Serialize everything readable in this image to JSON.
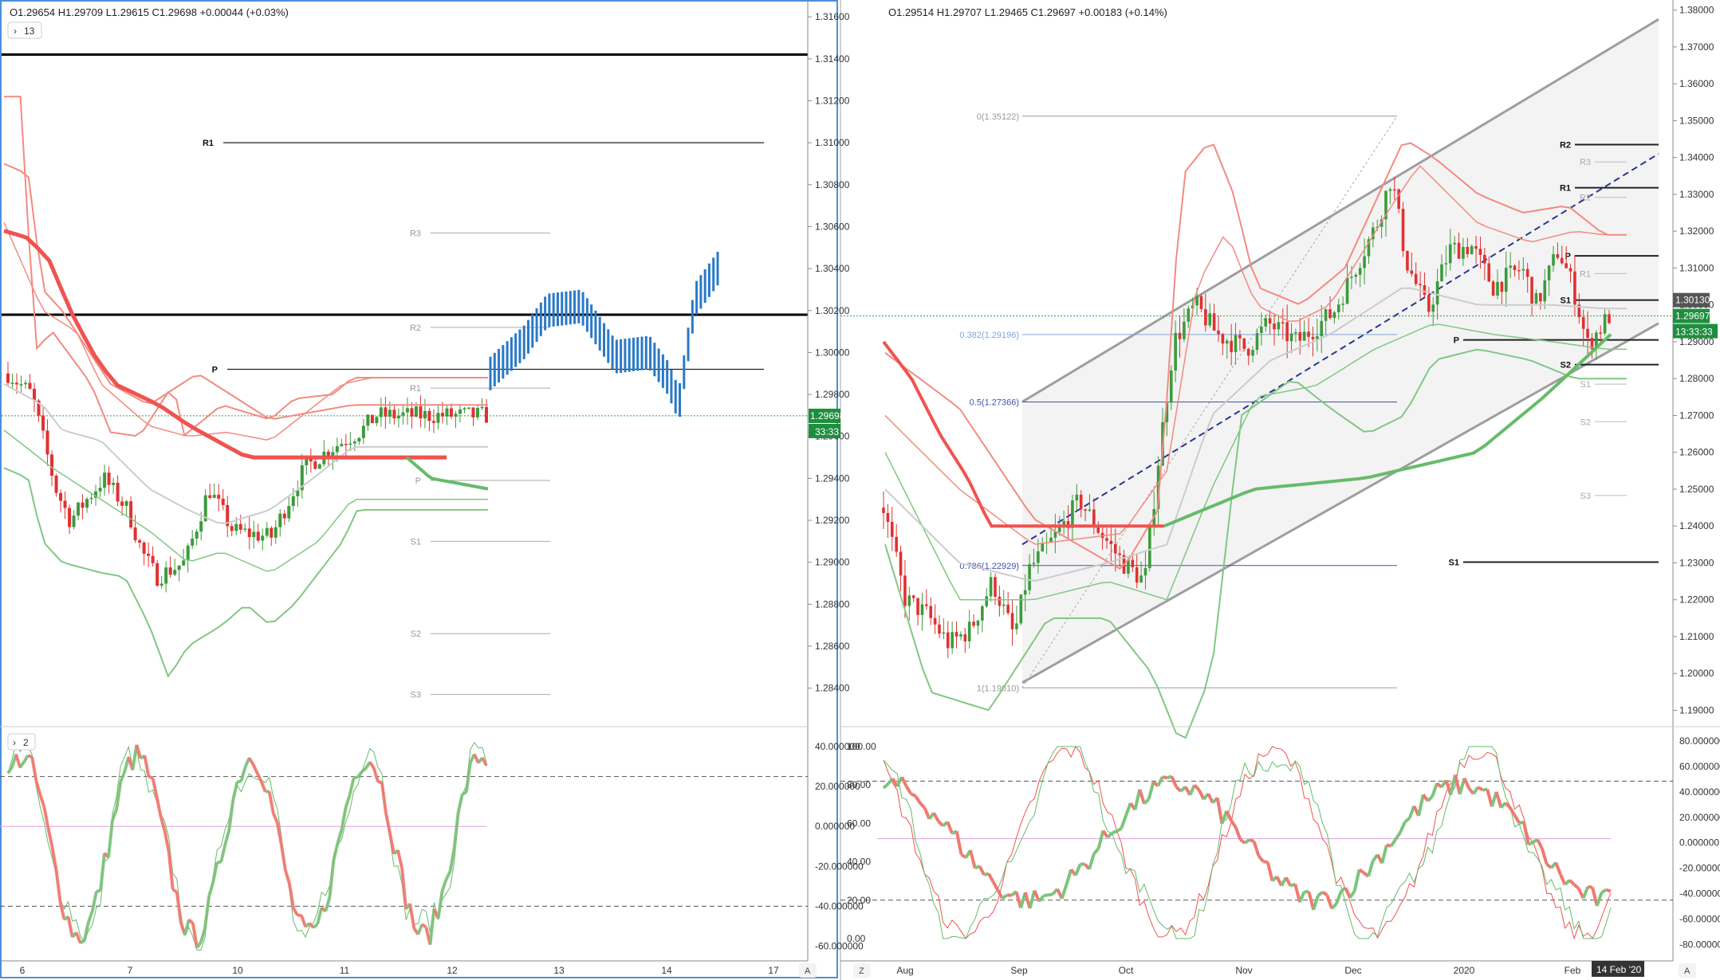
{
  "left_panel": {
    "ohlc": "O1.29654  H1.29709  L1.29615  C1.29698  +0.00044 (+0.03%)",
    "collapse_label": "13",
    "price_ticks": [
      "1.31600",
      "1.31400",
      "1.31200",
      "1.31000",
      "1.30800",
      "1.30600",
      "1.30400",
      "1.30200",
      "1.30000",
      "1.29800",
      "1.29600",
      "1.29400",
      "1.29200",
      "1.29000",
      "1.28800",
      "1.28600",
      "1.28400"
    ],
    "time_ticks": [
      "6",
      "7",
      "10",
      "11",
      "12",
      "13",
      "14",
      "17"
    ],
    "last_price": "1.29698",
    "countdown": "33:33",
    "pivots": [
      {
        "label": "R1",
        "value": 1.31,
        "bold": true
      },
      {
        "label": "R3",
        "value": 1.3057,
        "bold": false
      },
      {
        "label": "R2",
        "value": 1.3012,
        "bold": false
      },
      {
        "label": "P",
        "value": 1.2992,
        "bold": true
      },
      {
        "label": "R1",
        "value": 1.2983,
        "bold": false
      },
      {
        "label": "P",
        "value": 1.2939,
        "bold": false
      },
      {
        "label": "S1",
        "value": 1.291,
        "bold": false
      },
      {
        "label": "S2",
        "value": 1.2866,
        "bold": false
      },
      {
        "label": "S3",
        "value": 1.2837,
        "bold": false
      }
    ],
    "horizontal_lines": [
      1.3142,
      1.3018
    ],
    "osc_label": "2",
    "osc_ticks": [
      "40.000000",
      "20.000000",
      "0.000000",
      "-20.000000",
      "-40.000000",
      "-60.000000"
    ],
    "axis_a": "A"
  },
  "right_panel": {
    "ohlc": "O1.29514  H1.29707  L1.29465  C1.29697  +0.00183 (+0.14%)",
    "price_ticks": [
      "1.38000",
      "1.37000",
      "1.36000",
      "1.35000",
      "1.34000",
      "1.33000",
      "1.32000",
      "1.31000",
      "1.30000",
      "1.29000",
      "1.28000",
      "1.27000",
      "1.26000",
      "1.25000",
      "1.24000",
      "1.23000",
      "1.22000",
      "1.21000",
      "1.20000",
      "1.19000"
    ],
    "time_ticks": [
      "Aug",
      "Sep",
      "Oct",
      "Nov",
      "Dec",
      "2020",
      "Feb"
    ],
    "date_badge": "14 Feb '20",
    "axis_z": "Z",
    "axis_a": "A",
    "price_badge_1": "1.30130",
    "price_badge_2": "1.29697",
    "price_badge_3": "13:33:33",
    "fib_levels": [
      {
        "label": "0(1.35122)",
        "value": 1.35122
      },
      {
        "label": "0.382(1.29196)",
        "value": 1.29196
      },
      {
        "label": "0.5(1.27366)",
        "value": 1.27366
      },
      {
        "label": "0.786(1.22929)",
        "value": 1.22929
      },
      {
        "label": "1(1.19610)",
        "value": 1.1961
      }
    ],
    "pivots": [
      {
        "label": "R2",
        "value": 1.3435,
        "bold": true
      },
      {
        "label": "R3",
        "value": 1.3388,
        "bold": false
      },
      {
        "label": "R1",
        "value": 1.3318,
        "bold": true
      },
      {
        "label": "R2",
        "value": 1.3292,
        "bold": false
      },
      {
        "label": "P",
        "value": 1.3133,
        "bold": true
      },
      {
        "label": "R1",
        "value": 1.3085,
        "bold": false
      },
      {
        "label": "S1",
        "value": 1.3013,
        "bold": true
      },
      {
        "label": "P",
        "value": 1.2905,
        "bold": true
      },
      {
        "label": "S2",
        "value": 1.2838,
        "bold": true
      },
      {
        "label": "S1",
        "value": 1.2785,
        "bold": false
      },
      {
        "label": "S2",
        "value": 1.2683,
        "bold": false
      },
      {
        "label": "S3",
        "value": 1.2483,
        "bold": false
      },
      {
        "label": "S1",
        "value": 1.2302,
        "bold": true
      }
    ],
    "osc_left_ticks": [
      "100.00",
      "80.00",
      "60.00",
      "40.00",
      "20.00",
      "0.00"
    ],
    "osc_right_ticks": [
      "80.000000",
      "60.000000",
      "40.000000",
      "20.000000",
      "0.000000",
      "-20.000000",
      "-40.000000",
      "-60.000000",
      "-80.000000"
    ]
  },
  "colors": {
    "up": "#26a69a",
    "down": "#ef5350",
    "bull_bar": "#3c9b3c",
    "bear_bar": "#e03131",
    "blue_bar": "#2979c8",
    "band_red": "#f28b82",
    "band_green": "#81c784",
    "ema_red": "#ef5350",
    "ema_green": "#66bb6a",
    "channel": "#9e9e9e",
    "badge_green": "#1e8e3e"
  },
  "chart_data": [
    {
      "type": "candlestick",
      "title": "",
      "series": [
        {
          "name": "",
          "close_last": 1.29698
        }
      ],
      "ylim": [
        1.283,
        1.3165
      ],
      "x_categories": [
        "6",
        "7",
        "10",
        "11",
        "12",
        "13",
        "14",
        "17"
      ]
    },
    {
      "type": "candlestick",
      "title": "",
      "series": [
        {
          "name": "",
          "close_last": 1.29697
        }
      ],
      "ylim": [
        1.185,
        1.38
      ],
      "x_categories": [
        "Aug",
        "Sep",
        "Oct",
        "Nov",
        "Dec",
        "2020",
        "Feb"
      ]
    },
    {
      "type": "line",
      "ylim": [
        -65,
        50
      ],
      "levels": [
        25,
        -40,
        0
      ]
    },
    {
      "type": "line",
      "ylim": [
        -5,
        105
      ],
      "levels": [
        80,
        20,
        50
      ]
    }
  ]
}
